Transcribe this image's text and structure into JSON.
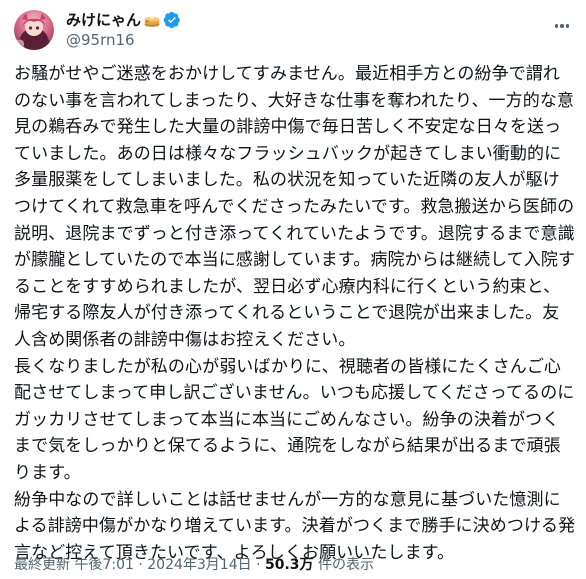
{
  "author": {
    "display_name": "みけにゃん",
    "emoji_icon": "pancake-icon",
    "verified_icon": "verified-badge-icon",
    "handle": "@95rn16"
  },
  "post": {
    "paragraphs": [
      "お騒がせやご迷惑をおかけしてすみません。最近相手方との紛争で謂れのない事を言われてしまったり、大好きな仕事を奪われたり、一方的な意見の鵜呑みで発生した大量の誹謗中傷で毎日苦しく不安定な日々を送っていました。あの日は様々なフラッシュバックが起きてしまい衝動的に多量服薬をしてしまいました。私の状況を知っていた近隣の友人が駆けつけてくれて救急車を呼んでくださったみたいです。救急搬送から医師の説明、退院までずっと付き添ってくれていたようです。退院するまで意識が朦朧としていたので本当に感謝しています。病院からは継続して入院することをすすめられましたが、翌日必ず心療内科に行くという約束と、帰宅する際友人が付き添ってくれるということで退院が出来ました。友人含め関係者の誹謗中傷はお控えください。",
      "長くなりましたが私の心が弱いばかりに、視聴者の皆様にたくさんご心配させてしまって申し訳ございません。いつも応援してくださってるのにガッカリさせてしまって本当に本当にごめんなさい。紛争の決着がつくまで気をしっかりと保てるように、通院をしながら結果が出るまで頑張ります。",
      "紛争中なので詳しいことは話せませんが一方的な意見に基づいた憶測による誹謗中傷がかなり増えています。決着がつくまで勝手に決めつける発言など控えて頂きたいです、よろしくお願いいたします。"
    ]
  },
  "meta": {
    "last_updated_label": "最終更新",
    "time": "午後7:01",
    "separator": "·",
    "date": "2024年3月14日",
    "views_count": "50.3万",
    "views_label": "件の表示"
  },
  "colors": {
    "text": "#0f1419",
    "secondary": "#536471",
    "verified": "#1d9bf0"
  }
}
